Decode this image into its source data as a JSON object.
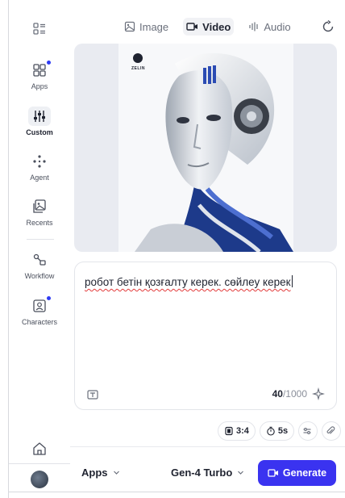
{
  "sidebar": {
    "top_icon": "grid-layout-icon",
    "items": [
      {
        "name": "apps",
        "label": "Apps",
        "icon": "apps-grid-icon",
        "badge": true
      },
      {
        "name": "custom",
        "label": "Custom",
        "icon": "sliders-icon",
        "active": true
      },
      {
        "name": "agent",
        "label": "Agent",
        "icon": "agent-nodes-icon"
      },
      {
        "name": "recents",
        "label": "Recents",
        "icon": "recents-images-icon"
      },
      {
        "name": "workflow",
        "label": "Workflow",
        "icon": "workflow-icon"
      },
      {
        "name": "characters",
        "label": "Characters",
        "icon": "characters-icon",
        "badge": true
      }
    ],
    "home_icon": "home-icon",
    "avatar": "user-avatar"
  },
  "tabs": [
    {
      "label": "Image",
      "icon": "image-icon",
      "active": false
    },
    {
      "label": "Video",
      "icon": "video-icon",
      "active": true
    },
    {
      "label": "Audio",
      "icon": "audio-wave-icon",
      "active": false
    }
  ],
  "preview": {
    "image": "robot-portrait",
    "logo_text": "ZELIN"
  },
  "prompt": {
    "text": "робот бетін қозғалту керек. сөйлеу керек",
    "counter_current": "40",
    "counter_max": "/1000"
  },
  "options": {
    "aspect_ratio": "3:4",
    "duration": "5s"
  },
  "bottombar": {
    "apps_label": "Apps",
    "model_label": "Gen-4 Turbo",
    "generate_label": "Generate"
  },
  "colors": {
    "accent": "#3a33f0",
    "badge": "#2f3cf3",
    "preview_bg": "#e9ebf1"
  }
}
